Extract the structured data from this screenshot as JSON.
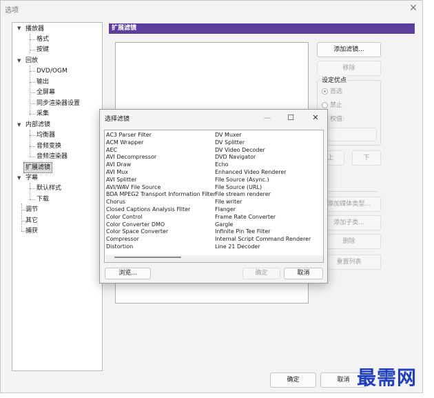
{
  "window": {
    "title": "选项",
    "close_icon": "✕"
  },
  "tree": {
    "items": [
      {
        "label": "播放器"
      },
      {
        "label": "格式"
      },
      {
        "label": "按键"
      },
      {
        "label": "回放"
      },
      {
        "label": "DVD/OGM"
      },
      {
        "label": "输出"
      },
      {
        "label": "全屏幕"
      },
      {
        "label": "同步渲染器设置"
      },
      {
        "label": "采集"
      },
      {
        "label": "内部滤镜"
      },
      {
        "label": "均衡器"
      },
      {
        "label": "音频变换"
      },
      {
        "label": "音频渲染器"
      },
      {
        "label": "扩展滤镜"
      },
      {
        "label": "字幕"
      },
      {
        "label": "默认样式"
      },
      {
        "label": "下载"
      },
      {
        "label": "调节"
      },
      {
        "label": "其它"
      },
      {
        "label": "捕获"
      }
    ]
  },
  "page": {
    "header": "扩展滤镜",
    "add_filter": "添加滤镜...",
    "remove": "移除",
    "priority_group": "设定优点",
    "prefer": "首选",
    "block": "禁止",
    "merit": "权值:",
    "up": "上",
    "down": "下",
    "add_media_type": "添加媒体类型...",
    "add_subtype": "添加子类...",
    "delete": "删除",
    "reset_list": "重置列表"
  },
  "footer": {
    "ok": "确定",
    "cancel": "取消"
  },
  "dialog": {
    "title": "选择滤镜",
    "minimize_icon": "—",
    "maximize_icon": "☐",
    "close_icon": "✕",
    "col1": [
      "AC3 Parser Filter",
      "ACM Wrapper",
      "AEC",
      "AVI Decompressor",
      "AVI Draw",
      "AVI Mux",
      "AVI Splitter",
      "AVI/WAV File Source",
      "BDA MPEG2 Transport Information Filter",
      "Chorus",
      "Closed Captions Analysis Filter",
      "Color Control",
      "Color Converter DMO",
      "Color Space Converter",
      "Compressor",
      "Distortion"
    ],
    "col2": [
      "DV Muxer",
      "DV Splitter",
      "DV Video Decoder",
      "DVD Navigator",
      "Echo",
      "Enhanced Video Renderer",
      "File Source (Async.)",
      "File Source (URL)",
      "File stream renderer",
      "File writer",
      "Flanger",
      "Frame Rate Converter",
      "Gargle",
      "Infinite Pin Tee Filter",
      "Internal Script Command Renderer",
      "Line 21 Decoder"
    ],
    "browse": "浏览...",
    "ok": "确定",
    "cancel": "取消"
  },
  "watermark": "最需网"
}
